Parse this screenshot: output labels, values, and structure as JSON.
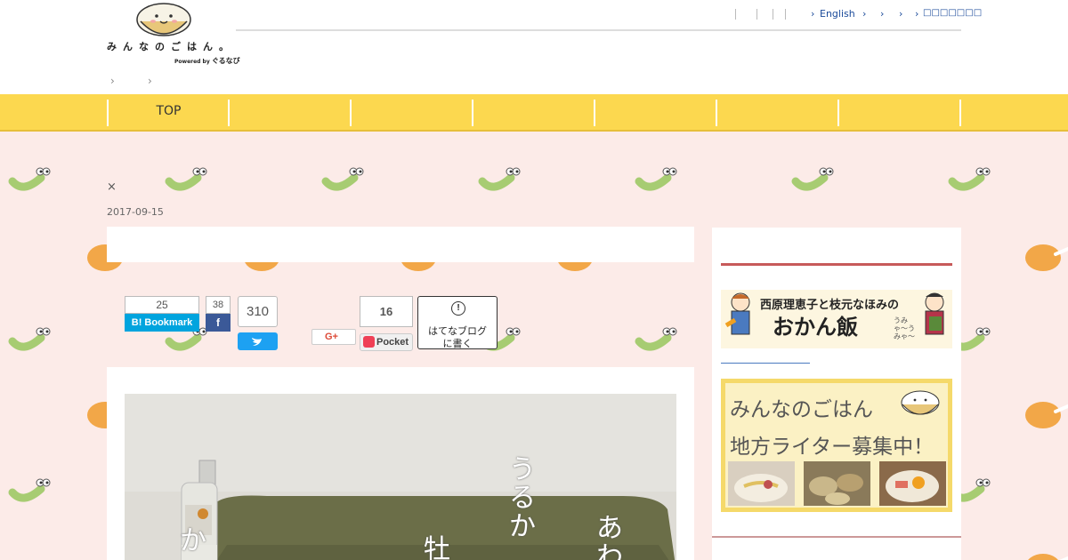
{
  "header": {
    "logo_text": "みんなのごはん。",
    "logo_powered": "Powered by",
    "logo_brand": "ぐるなび",
    "top_nav": {
      "english_label": "English",
      "last_label": "□□□□□□□"
    },
    "breadcrumb": [
      "›",
      "›"
    ]
  },
  "global_nav": {
    "items": [
      "TOP",
      "",
      "",
      "",
      "",
      "",
      "",
      ""
    ]
  },
  "article": {
    "close_mark": "×",
    "date": "2017-09-15",
    "hero_text_1": "うるか",
    "hero_text_2": "あわ",
    "hero_text_3": "牡",
    "hero_text_4": "か"
  },
  "share": {
    "hatena_count": "25",
    "hatena_label": "B! Bookmark",
    "facebook_count": "38",
    "facebook_label": "f",
    "twitter_count": "310",
    "gplus_label": "G+",
    "pocket_count": "16",
    "pocket_label": "Pocket",
    "hatena_blog_line1": "はてなブログ",
    "hatena_blog_line2": "に書く"
  },
  "sidebar": {
    "banner1_title": "西原理恵子と枝元なほみの",
    "banner1_main": "おかん飯",
    "banner1_sub": "うみゃ〜うみゃ〜",
    "banner2_line1": "みんなのごはん",
    "banner2_line2": "地方ライター募集中！"
  },
  "colors": {
    "nav_yellow": "#fcd84f",
    "page_pink": "#fcebe8",
    "link_blue": "#1a4a9a",
    "hatena_blue": "#00a4de",
    "facebook_blue": "#3b5998",
    "twitter_blue": "#1da1f2",
    "pocket_red": "#ef4056"
  }
}
